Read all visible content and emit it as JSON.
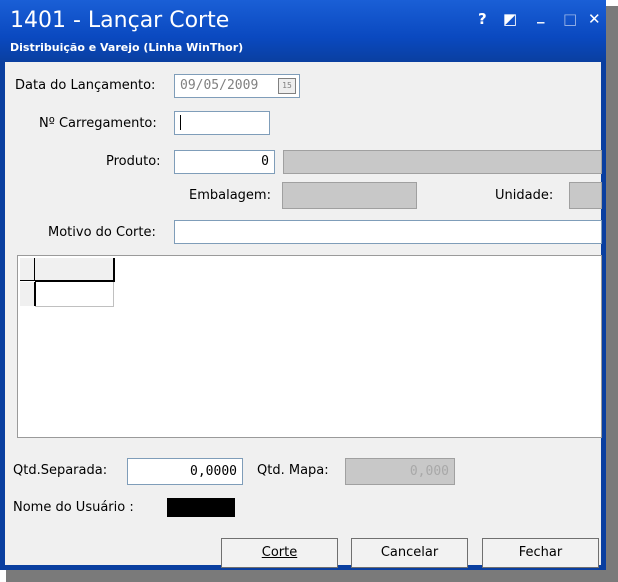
{
  "window": {
    "title": "1401 - Lançar Corte",
    "subtitle": "Distribuição e Varejo (Linha WinThor)",
    "help_glyph": "?",
    "restore_glyph": "◩",
    "minimize_glyph": "_",
    "maximize_glyph": "□",
    "close_glyph": "✕"
  },
  "form": {
    "data_lancamento_label": "Data do Lançamento:",
    "data_lancamento_value": "09/05/2009",
    "calendar_icon_text": "15",
    "carregamento_label": "Nº Carregamento:",
    "carregamento_value": "",
    "produto_label": "Produto:",
    "produto_value": "0",
    "produto_desc": "",
    "embalagem_label": "Embalagem:",
    "embalagem_value": "",
    "unidade_label": "Unidade:",
    "unidade_value": "",
    "motivo_label": "Motivo do Corte:",
    "motivo_value": "",
    "qtd_separada_label": "Qtd.Separada:",
    "qtd_separada_value": "0,0000",
    "qtd_mapa_label": "Qtd. Mapa:",
    "qtd_mapa_value": "0,000",
    "usuario_label": "Nome do Usuário :",
    "usuario_value": ""
  },
  "buttons": {
    "corte": "Corte",
    "cancelar": "Cancelar",
    "fechar": "Fechar"
  },
  "colors": {
    "titlebar": "#0a49c0",
    "disabled_field": "#c8c8c8"
  }
}
